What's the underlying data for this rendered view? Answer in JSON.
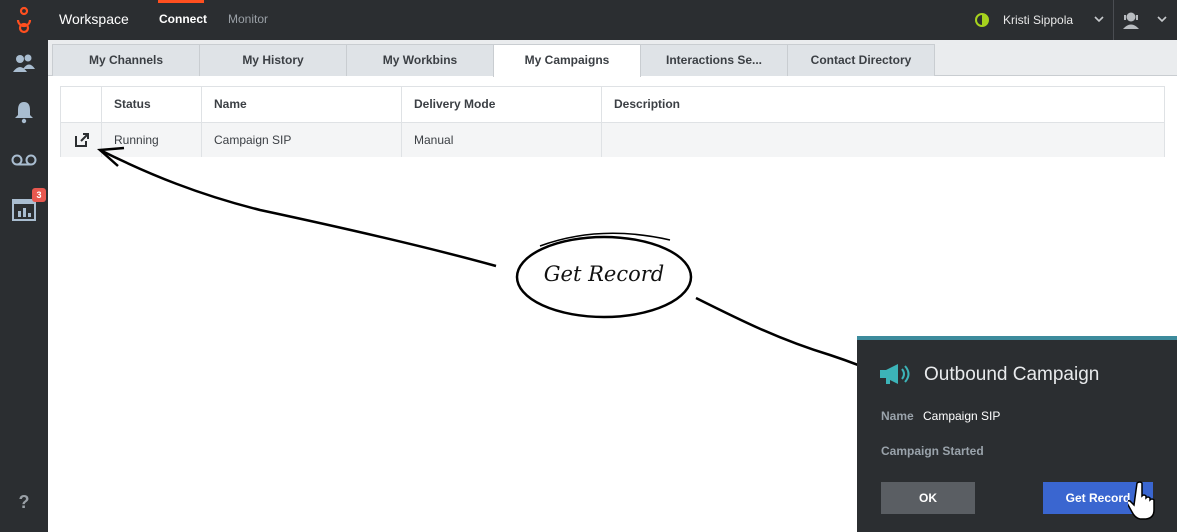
{
  "header": {
    "app_title": "Workspace",
    "nav": {
      "connect": "Connect",
      "monitor": "Monitor"
    },
    "user_name": "Kristi Sippola",
    "accent": "#ff4f1f",
    "status_color": "#a6d21e"
  },
  "sidebar": {
    "icons": [
      "contacts-icon",
      "bell-icon",
      "voicemail-icon",
      "reports-icon"
    ],
    "reports_badge": "3",
    "help": "?"
  },
  "tabs": [
    "My Channels",
    "My History",
    "My Workbins",
    "My Campaigns",
    "Interactions Se...",
    "Contact Directory"
  ],
  "active_tab": "My Campaigns",
  "grid": {
    "columns": [
      "Status",
      "Name",
      "Delivery Mode",
      "Description"
    ],
    "rows": [
      {
        "status": "Running",
        "name": "Campaign SIP",
        "delivery_mode": "Manual",
        "description": ""
      }
    ]
  },
  "callout": {
    "text": "Get Record"
  },
  "popup": {
    "title": "Outbound Campaign",
    "name_label": "Name",
    "name_value": "Campaign SIP",
    "status_text": "Campaign Started",
    "ok_label": "OK",
    "get_record_label": "Get Record",
    "accent": "#3d8b9c",
    "button_color": "#3a66d0"
  }
}
